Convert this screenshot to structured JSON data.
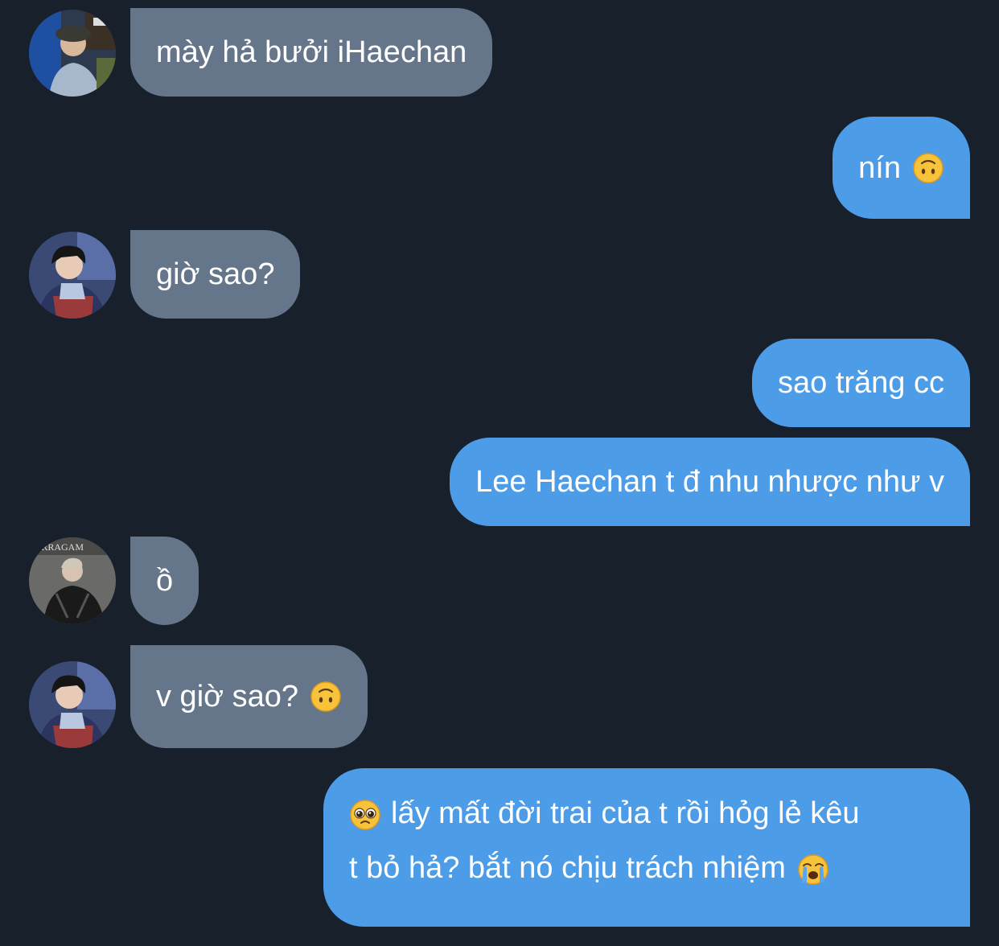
{
  "messages": [
    {
      "side": "in",
      "text": "mày hả bưởi iHaechan",
      "avatar": "avatar-1"
    },
    {
      "side": "out",
      "text": "nín",
      "emoji": "upside-down-face"
    },
    {
      "side": "in",
      "text": "giờ sao?",
      "avatar": "avatar-2"
    },
    {
      "side": "out",
      "text": "sao trăng cc"
    },
    {
      "side": "out",
      "text": "Lee Haechan t đ nhu nhược như v"
    },
    {
      "side": "in",
      "text": "ồ",
      "avatar": "avatar-3"
    },
    {
      "side": "in",
      "text": "v giờ sao?",
      "emoji": "upside-down-face",
      "avatar": "avatar-2"
    },
    {
      "side": "out",
      "lines": [
        "lấy mất đời trai của t rồi hỏg lẻ kêu",
        "t bỏ hả? bắt nó chịu trách nhiệm"
      ],
      "lead_emoji": "pleading-face",
      "trail_emoji": "loudly-crying-face"
    }
  ],
  "colors": {
    "background": "#17202b",
    "incoming_bubble": "#66768a",
    "outgoing_bubble": "#4c9ce8",
    "text": "#ffffff"
  }
}
